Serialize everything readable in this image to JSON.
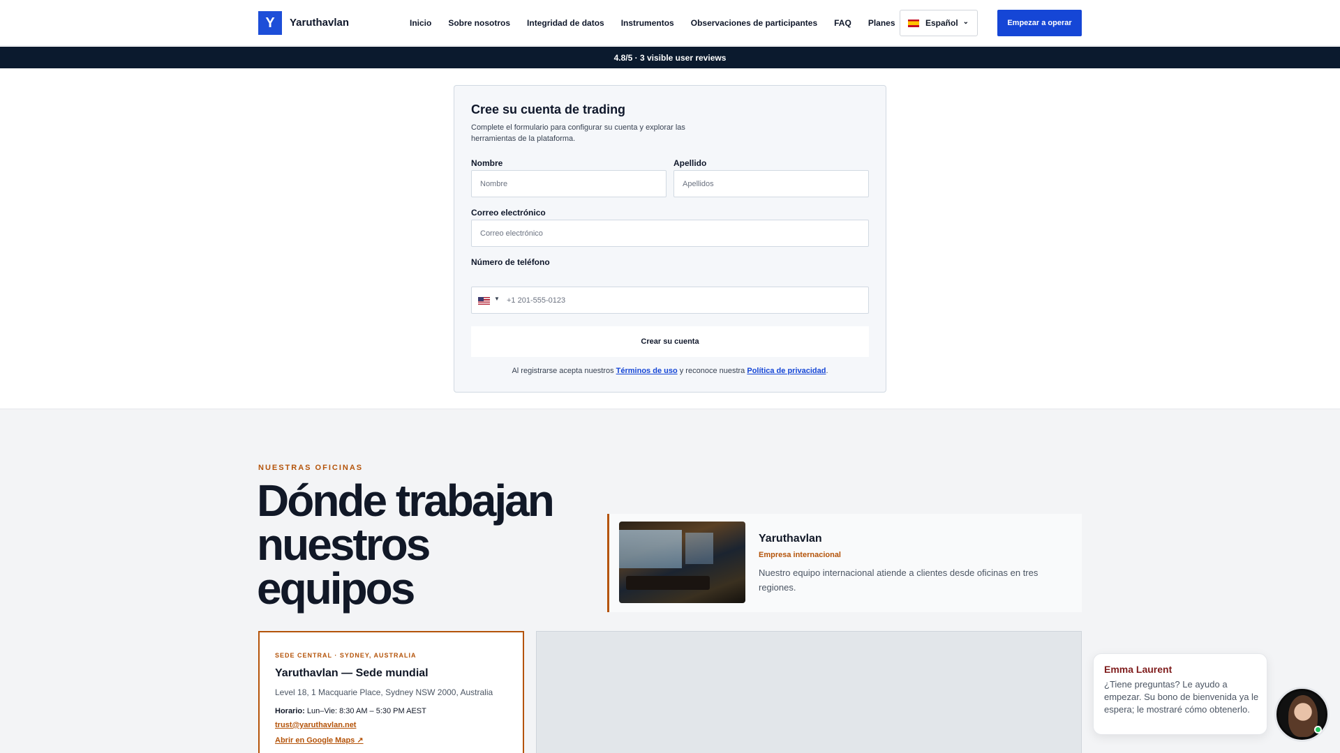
{
  "header": {
    "logo_letter": "Y",
    "brand": "Yaruthavlan",
    "nav": [
      "Inicio",
      "Sobre nosotros",
      "Integridad de datos",
      "Instrumentos",
      "Observaciones de participantes",
      "FAQ",
      "Planes"
    ],
    "language": "Español",
    "cta": "Empezar a operar"
  },
  "ribbon": {
    "text": "4.8/5 · 3 visible user reviews"
  },
  "form": {
    "title": "Cree su cuenta de trading",
    "subtitle": "Complete el formulario para configurar su cuenta y explorar las herramientas de la plataforma.",
    "first_name_label": "Nombre",
    "first_name_placeholder": "Nombre",
    "last_name_label": "Apellido",
    "last_name_placeholder": "Apellidos",
    "email_label": "Correo electrónico",
    "email_placeholder": "Correo electrónico",
    "phone_label": "Número de teléfono",
    "phone_placeholder": "+1 201-555-0123",
    "submit": "Crear su cuenta",
    "legal_prefix": "Al registrarse acepta nuestros",
    "terms": "Términos de uso",
    "legal_mid": "y reconoce nuestra",
    "privacy": "Política de privacidad",
    "legal_suffix": "."
  },
  "offices": {
    "eyebrow": "NUESTRAS OFICINAS",
    "title": "Dónde trabajan nuestros equipos",
    "intl": {
      "name": "Yaruthavlan",
      "tag": "Empresa internacional",
      "description": "Nuestro equipo internacional atiende a clientes desde oficinas en tres regiones."
    },
    "hq": {
      "kicker": "SEDE CENTRAL · SYDNEY, AUSTRALIA",
      "title": "Yaruthavlan — Sede mundial",
      "address": "Level 18, 1 Macquarie Place, Sydney NSW 2000, Australia",
      "hours_label": "Horario:",
      "hours": "Lun–Vie: 8:30 AM – 5:30 PM AEST",
      "email": "trust@yaruthavlan.net",
      "maps_link": "Abrir en Google Maps ↗"
    }
  },
  "chat": {
    "name": "Emma Laurent",
    "message": "¿Tiene preguntas? Le ayudo a empezar. Su bono de bienvenida ya le espera; le mostraré cómo obtenerlo."
  },
  "colors": {
    "primary": "#1546d6",
    "accent": "#b45309",
    "ribbon": "#0b1a2e"
  }
}
